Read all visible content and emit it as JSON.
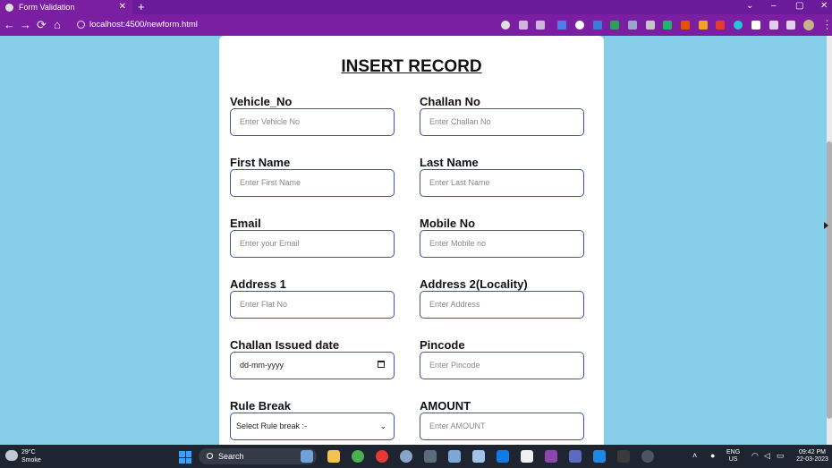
{
  "browser": {
    "tab_title": "Form Validation",
    "tab_close": "✕",
    "new_tab": "+",
    "url": "localhost:4500/newform.html",
    "window_minimize": "–",
    "window_maximize": "▢",
    "window_close": "✕",
    "tab_search": "⌄",
    "back": "←",
    "forward": "→",
    "reload": "⟳",
    "home": "⌂",
    "menu": "⋮"
  },
  "form": {
    "title": "INSERT RECORD",
    "fields": {
      "vehicle_no": {
        "label": "Vehicle_No",
        "placeholder": "Enter Vehicle No"
      },
      "challan_no": {
        "label": "Challan No",
        "placeholder": "Enter Challan No"
      },
      "first_name": {
        "label": "First Name",
        "placeholder": "Enter First Name"
      },
      "last_name": {
        "label": "Last Name",
        "placeholder": "Enter Last Name"
      },
      "email": {
        "label": "Email",
        "placeholder": "Enter your Email"
      },
      "mobile_no": {
        "label": "Mobile No",
        "placeholder": "Enter Mobile no"
      },
      "address1": {
        "label": "Address 1",
        "placeholder": "Enter Flat No"
      },
      "address2": {
        "label": "Address 2(Locality)",
        "placeholder": "Enter Address"
      },
      "issued_date": {
        "label": "Challan Issued date",
        "value": "dd-mm-yyyy"
      },
      "pincode": {
        "label": "Pincode",
        "placeholder": "Enter Pincode"
      },
      "rule_break": {
        "label": "Rule Break",
        "value": "Select Rule break :-"
      },
      "amount": {
        "label": "AMOUNT",
        "placeholder": "Enter AMOUNT"
      }
    }
  },
  "taskbar": {
    "temperature": "29°C",
    "weather": "Smoke",
    "search": "Search",
    "language_top": "ENG",
    "language_bottom": "US",
    "time": "09:42 PM",
    "date": "22-03-2023"
  },
  "colors": {
    "browser_frame": "#7b1fa2",
    "page_background": "#87ceeb",
    "input_border": "#3f51b5"
  }
}
